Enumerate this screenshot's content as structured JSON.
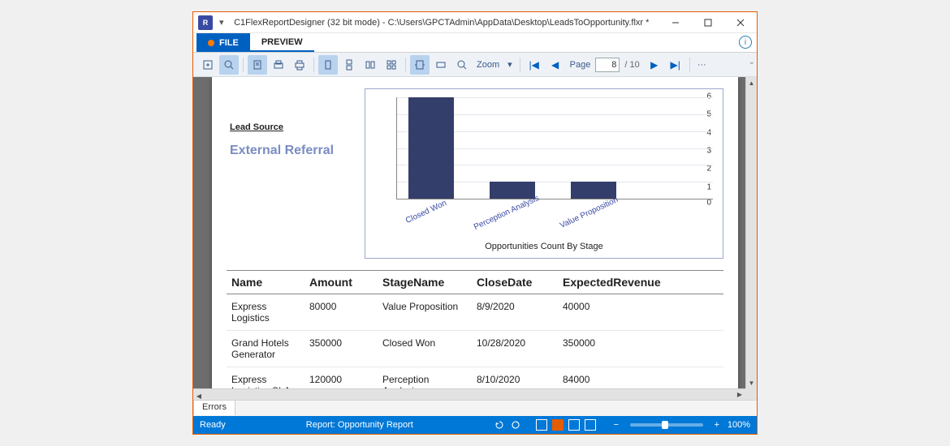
{
  "window": {
    "title": "C1FlexReportDesigner (32 bit mode) - C:\\Users\\GPCTAdmin\\AppData\\Desktop\\LeadsToOpportunity.flxr *"
  },
  "tabs": {
    "file": "FILE",
    "preview": "PREVIEW"
  },
  "toolbar": {
    "zoom_label": "Zoom",
    "page_label": "Page",
    "page_current": "8",
    "page_total": "/ 10",
    "more": "···"
  },
  "report": {
    "lead_source_label": "Lead Source",
    "lead_source_value": "External Referral",
    "chart_caption": "Opportunities Count By Stage",
    "columns": {
      "name": "Name",
      "amount": "Amount",
      "stage": "StageName",
      "close": "CloseDate",
      "rev": "ExpectedRevenue"
    },
    "rows": [
      {
        "name": "Express Logistics",
        "amount": "80000",
        "stage": "Value Proposition",
        "close": "8/9/2020",
        "rev": "40000"
      },
      {
        "name": "Grand Hotels Generator",
        "amount": "350000",
        "stage": "Closed Won",
        "close": "10/28/2020",
        "rev": "350000"
      },
      {
        "name": "Express Logistics SLA",
        "amount": "120000",
        "stage": "Perception Analysis",
        "close": "8/10/2020",
        "rev": "84000"
      }
    ]
  },
  "chart_data": {
    "type": "bar",
    "title": "Opportunities Count By Stage",
    "xlabel": "",
    "ylabel": "",
    "categories": [
      "Closed Won",
      "Perception Analysis",
      "Value Proposition"
    ],
    "values": [
      6,
      1,
      1
    ],
    "ylim": [
      0,
      6
    ],
    "yticks": [
      0,
      1,
      2,
      3,
      4,
      5,
      6
    ]
  },
  "errors": {
    "tab": "Errors"
  },
  "status": {
    "ready": "Ready",
    "center": "Report: Opportunity Report",
    "zoom_pct": "100%"
  }
}
